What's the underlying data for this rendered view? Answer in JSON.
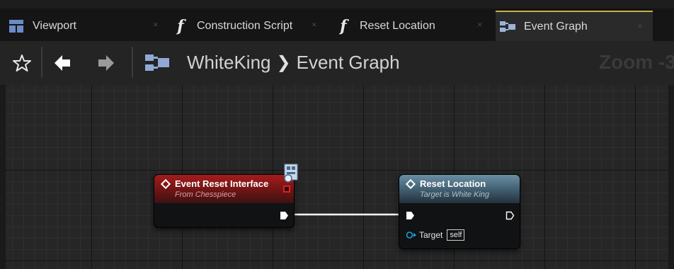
{
  "tabs": [
    {
      "label": "Viewport",
      "icon": "viewport-icon"
    },
    {
      "label": "Construction Script",
      "icon": "function-icon"
    },
    {
      "label": "Reset Location",
      "icon": "function-icon"
    },
    {
      "label": "Event Graph",
      "icon": "event-graph-icon"
    }
  ],
  "toolbar": {
    "breadcrumb": [
      "WhiteKing",
      "Event Graph"
    ],
    "zoom_label": "Zoom -3"
  },
  "nodes": {
    "event": {
      "title": "Event Reset Interface",
      "subtitle": "From Chesspiece",
      "color": "#a51c1c"
    },
    "call": {
      "title": "Reset Location",
      "subtitle": "Target is White King",
      "target_label": "Target",
      "target_value": "self",
      "color": "#6a8fa3"
    }
  },
  "colors": {
    "active_tab_accent": "#c8b04a",
    "exec_wire": "#ffffff",
    "object_pin": "#1ea0d8"
  }
}
